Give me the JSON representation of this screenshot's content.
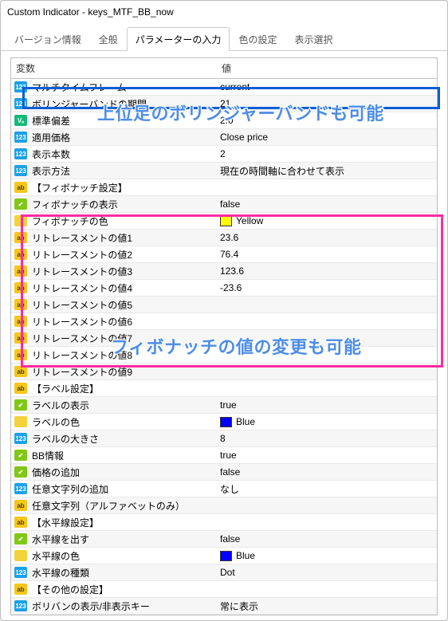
{
  "title": "Custom Indicator - keys_MTF_BB_now",
  "tabs": [
    "バージョン情報",
    "全般",
    "パラメーターの入力",
    "色の設定",
    "表示選択"
  ],
  "activeTab": 2,
  "headers": {
    "name": "変数",
    "value": "値"
  },
  "annotations": {
    "a1": "上位足のボリンジャーバンドも可能",
    "a2": "フィボナッチの値の変更も可能"
  },
  "rows": [
    {
      "icon": "num",
      "name": "マルチタイムフレーム",
      "value": "current"
    },
    {
      "icon": "num",
      "name": "ボリンジャーバンドの期間",
      "value": "21"
    },
    {
      "icon": "va",
      "name": "標準偏差",
      "value": "2.0"
    },
    {
      "icon": "num",
      "name": "適用価格",
      "value": "Close price"
    },
    {
      "icon": "num",
      "name": "表示本数",
      "value": "2"
    },
    {
      "icon": "num",
      "name": "表示方法",
      "value": "現在の時間軸に合わせて表示"
    },
    {
      "icon": "ab",
      "name": "【フィボナッチ設定】",
      "value": ""
    },
    {
      "icon": "sig",
      "name": "フィボナッチの表示",
      "value": "false"
    },
    {
      "icon": "col",
      "name": "フィボナッチの色",
      "value": "Yellow",
      "swatch": "#ffff00"
    },
    {
      "icon": "ab",
      "name": "リトレースメントの値1",
      "value": "23.6"
    },
    {
      "icon": "ab",
      "name": "リトレースメントの値2",
      "value": "76.4"
    },
    {
      "icon": "ab",
      "name": "リトレースメントの値3",
      "value": "123.6"
    },
    {
      "icon": "ab",
      "name": "リトレースメントの値4",
      "value": "-23.6"
    },
    {
      "icon": "ab",
      "name": "リトレースメントの値5",
      "value": ""
    },
    {
      "icon": "ab",
      "name": "リトレースメントの値6",
      "value": ""
    },
    {
      "icon": "ab",
      "name": "リトレースメントの値7",
      "value": ""
    },
    {
      "icon": "ab",
      "name": "リトレースメントの値8",
      "value": ""
    },
    {
      "icon": "ab",
      "name": "リトレースメントの値9",
      "value": ""
    },
    {
      "icon": "ab",
      "name": "【ラベル設定】",
      "value": ""
    },
    {
      "icon": "sig",
      "name": "ラベルの表示",
      "value": "true"
    },
    {
      "icon": "col",
      "name": "ラベルの色",
      "value": "Blue",
      "swatch": "#0000ff"
    },
    {
      "icon": "num",
      "name": "ラベルの大きさ",
      "value": "8"
    },
    {
      "icon": "sig",
      "name": "BB情報",
      "value": "true"
    },
    {
      "icon": "sig",
      "name": "価格の追加",
      "value": "false"
    },
    {
      "icon": "num",
      "name": "任意文字列の追加",
      "value": "なし"
    },
    {
      "icon": "ab",
      "name": "任意文字列（アルファベットのみ）",
      "value": ""
    },
    {
      "icon": "ab",
      "name": "【水平線設定】",
      "value": ""
    },
    {
      "icon": "sig",
      "name": "水平線を出す",
      "value": "false"
    },
    {
      "icon": "col",
      "name": "水平線の色",
      "value": "Blue",
      "swatch": "#0000ff"
    },
    {
      "icon": "num",
      "name": "水平線の種類",
      "value": "Dot"
    },
    {
      "icon": "ab",
      "name": "【その他の設定】",
      "value": ""
    },
    {
      "icon": "num",
      "name": "ボリバンの表示/非表示キー",
      "value": "常に表示"
    }
  ],
  "iconText": {
    "num": "123",
    "va": "Vₐ",
    "ab": "ab",
    "sig": "✔",
    "col": ""
  }
}
